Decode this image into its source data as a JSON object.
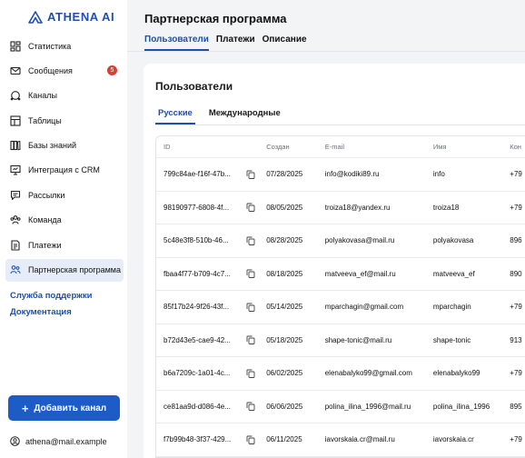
{
  "app": {
    "brand": "ATHENA AI"
  },
  "sidebar": {
    "items": [
      {
        "label": "Статистика",
        "icon": "dashboard-icon"
      },
      {
        "label": "Сообщения",
        "icon": "mail-icon",
        "badge": "5"
      },
      {
        "label": "Каналы",
        "icon": "channels-icon"
      },
      {
        "label": "Таблицы",
        "icon": "table-icon"
      },
      {
        "label": "Базы знаний",
        "icon": "knowledge-base-icon"
      },
      {
        "label": "Интеграция с CRM",
        "icon": "crm-icon"
      },
      {
        "label": "Рассылки",
        "icon": "newsletter-icon"
      },
      {
        "label": "Команда",
        "icon": "team-icon"
      },
      {
        "label": "Платежи",
        "icon": "payments-icon"
      },
      {
        "label": "Партнерская программа",
        "icon": "partner-icon",
        "active": true
      }
    ],
    "support_link": "Служба поддержки",
    "docs_link": "Документация",
    "add_channel": "Добавить канал",
    "user_email": "athena@mail.example"
  },
  "header": {
    "title": "Партнерская программа",
    "tabs": [
      "Пользователи",
      "Платежи",
      "Описание"
    ]
  },
  "users": {
    "title": "Пользователи",
    "tabs": [
      "Русские",
      "Международные"
    ],
    "columns": [
      "ID",
      "Создан",
      "E-mail",
      "Имя",
      "Кон"
    ],
    "rows": [
      {
        "id": "799c84ae-f16f-47b...",
        "created": "07/28/2025",
        "email": "info@kodiki89.ru",
        "name": "info",
        "contact": "+79"
      },
      {
        "id": "98190977-6808-4f...",
        "created": "08/05/2025",
        "email": "troiza18@yandex.ru",
        "name": "troiza18",
        "contact": "+79"
      },
      {
        "id": "5c48e3f8-510b-46...",
        "created": "08/28/2025",
        "email": "polyakovasa@mail.ru",
        "name": "polyakovasa",
        "contact": "896"
      },
      {
        "id": "fbaa4f77-b709-4c7...",
        "created": "08/18/2025",
        "email": "matveeva_ef@mail.ru",
        "name": "matveeva_ef",
        "contact": "890"
      },
      {
        "id": "85f17b24-9f26-43f...",
        "created": "05/14/2025",
        "email": "mparchagin@gmail.com",
        "name": "mparchagin",
        "contact": "+79"
      },
      {
        "id": "b72d43e5-cae9-42...",
        "created": "05/18/2025",
        "email": "shape-tonic@mail.ru",
        "name": "shape-tonic",
        "contact": "913"
      },
      {
        "id": "b6a7209c-1a01-4c...",
        "created": "06/02/2025",
        "email": "elenabalyko99@gmail.com",
        "name": "elenabalyko99",
        "contact": "+79"
      },
      {
        "id": "ce81aa9d-d086-4e...",
        "created": "06/06/2025",
        "email": "polina_ilina_1996@mail.ru",
        "name": "polina_ilina_1996",
        "contact": "895"
      },
      {
        "id": "f7b99b48-3f37-429...",
        "created": "06/11/2025",
        "email": "iavorskaia.cr@mail.ru",
        "name": "iavorskaia.cr",
        "contact": "+79"
      }
    ]
  },
  "colors": {
    "accent": "#1d5cc6",
    "badge": "#e53935",
    "active_bg": "#e6edf8"
  }
}
